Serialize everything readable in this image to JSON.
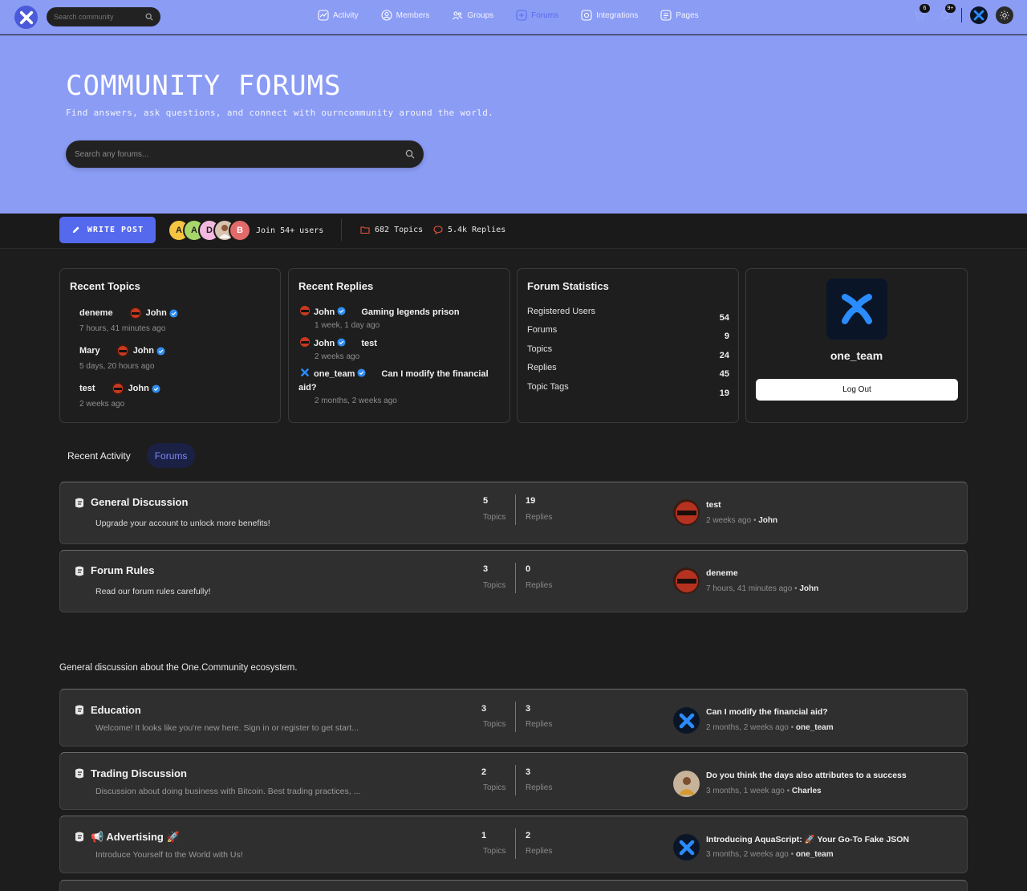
{
  "nav": {
    "search_placeholder": "Search community",
    "links": [
      "Activity",
      "Members",
      "Groups",
      "Forums",
      "Integrations",
      "Pages"
    ],
    "active_link": "Forums",
    "notifications_badge": "6",
    "messages_badge": "9+"
  },
  "hero": {
    "title": "COMMUNITY FORUMS",
    "subtitle": "Find answers, ask questions, and connect with ourncommunity around the world.",
    "search_placeholder": "Search any forums..."
  },
  "actions": {
    "write_post": "WRITE POST",
    "avatars": [
      "A",
      "A",
      "D",
      "",
      "B"
    ],
    "join_text": "Join 54+ users",
    "topics": "682 Topics",
    "replies": "5.4k Replies"
  },
  "recent_topics": {
    "title": "Recent Topics",
    "items": [
      {
        "topic": "deneme",
        "author": "John",
        "time": "7 hours, 41 minutes ago"
      },
      {
        "topic": "Mary",
        "author": "John",
        "time": "5 days, 20 hours ago"
      },
      {
        "topic": "test",
        "author": "John",
        "time": "2 weeks ago"
      }
    ]
  },
  "recent_replies": {
    "title": "Recent Replies",
    "items": [
      {
        "author": "John",
        "topic": "Gaming legends prison",
        "time": "1 week, 1 day ago"
      },
      {
        "author": "John",
        "topic": "test",
        "time": "2 weeks ago"
      },
      {
        "author": "one_team",
        "topic": "Can I modify the financial aid?",
        "time": "2 months, 2 weeks ago"
      }
    ]
  },
  "forum_stats": {
    "title": "Forum Statistics",
    "rows": [
      {
        "label": "Registered Users",
        "value": "54"
      },
      {
        "label": "Forums",
        "value": "9"
      },
      {
        "label": "Topics",
        "value": "24"
      },
      {
        "label": "Replies",
        "value": "45"
      },
      {
        "label": "Topic Tags",
        "value": "19"
      }
    ]
  },
  "profile": {
    "name": "one_team",
    "logout": "Log Out"
  },
  "tabs": {
    "recent": "Recent Activity",
    "forums": "Forums"
  },
  "forums_top": [
    {
      "title": "General Discussion",
      "desc": "Upgrade your account to unlock more benefits!",
      "topics": "5",
      "replies": "19",
      "last": "test",
      "time": "2 weeks ago",
      "by": "John"
    },
    {
      "title": "Forum Rules",
      "desc": "Read our forum rules carefully!",
      "topics": "3",
      "replies": "0",
      "last": "deneme",
      "time": "7 hours, 41 minutes ago",
      "by": "John"
    }
  ],
  "section": {
    "description": "General discussion about the One.Community ecosystem."
  },
  "forums_bottom": [
    {
      "title": "Education",
      "desc": "Welcome! It looks like you're new here. Sign in or register to get start...",
      "topics": "3",
      "replies": "3",
      "last": "Can I modify the financial aid?",
      "time": "2 months, 2 weeks ago",
      "by": "one_team"
    },
    {
      "title": "Trading Discussion",
      "desc": "Discussion about doing business with Bitcoin. Best trading practices, ...",
      "topics": "2",
      "replies": "3",
      "last": "Do you think the days also attributes to a success",
      "time": "3 months, 1 week ago",
      "by": "Charles"
    },
    {
      "title": "📢 Advertising 🚀",
      "desc": "Introduce Yourself to the World with Us!",
      "topics": "1",
      "replies": "2",
      "last": "Introducing AquaScript: 🚀 Your Go-To Fake JSON",
      "time": "3 months, 2 weeks ago",
      "by": "one_team"
    }
  ],
  "labels": {
    "topics": "Topics",
    "replies": "Replies",
    "dot": "•"
  },
  "colors": {
    "accent": "#5569ee",
    "hero": "#8b9cf5",
    "background": "#1d1d1d",
    "card": "#1e1e1e",
    "row": "#2f2f2f"
  }
}
